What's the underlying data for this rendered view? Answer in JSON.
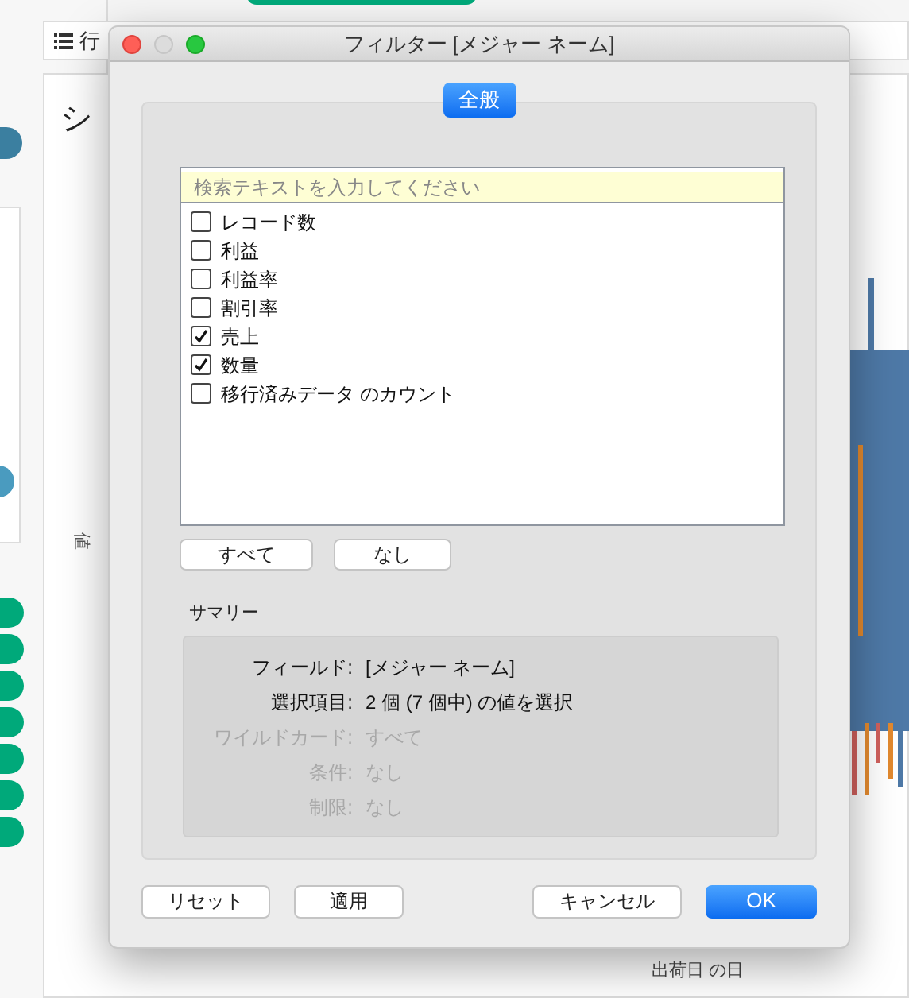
{
  "background": {
    "rows_shelf_label": "行",
    "sheet_title": "シ",
    "axis_label": "値",
    "x_axis_title": "出荷日 の日"
  },
  "dialog": {
    "title": "フィルター [メジャー ネーム]",
    "tabs": [
      {
        "label": "全般",
        "selected": true
      }
    ],
    "search": {
      "placeholder": "検索テキストを入力してください"
    },
    "items": [
      {
        "label": "レコード数",
        "checked": false
      },
      {
        "label": "利益",
        "checked": false
      },
      {
        "label": "利益率",
        "checked": false
      },
      {
        "label": "割引率",
        "checked": false
      },
      {
        "label": "売上",
        "checked": true
      },
      {
        "label": "数量",
        "checked": true
      },
      {
        "label": "移行済みデータ のカウント",
        "checked": false
      }
    ],
    "list_buttons": [
      "すべて",
      "なし"
    ],
    "summary": {
      "title": "サマリー",
      "rows": [
        {
          "label": "フィールド:",
          "value": "[メジャー ネーム]",
          "disabled": false
        },
        {
          "label": "選択項目:",
          "value": "2 個 (7 個中) の値を選択",
          "disabled": false
        },
        {
          "label": "ワイルドカード:",
          "value": "すべて",
          "disabled": true
        },
        {
          "label": "条件:",
          "value": "なし",
          "disabled": true
        },
        {
          "label": "制限:",
          "value": "なし",
          "disabled": true
        }
      ]
    },
    "buttons": [
      {
        "label": "リセット",
        "kind": "normal"
      },
      {
        "label": "適用",
        "kind": "normal"
      },
      {
        "label": "キャンセル",
        "kind": "normal"
      },
      {
        "label": "OK",
        "kind": "default"
      }
    ]
  }
}
